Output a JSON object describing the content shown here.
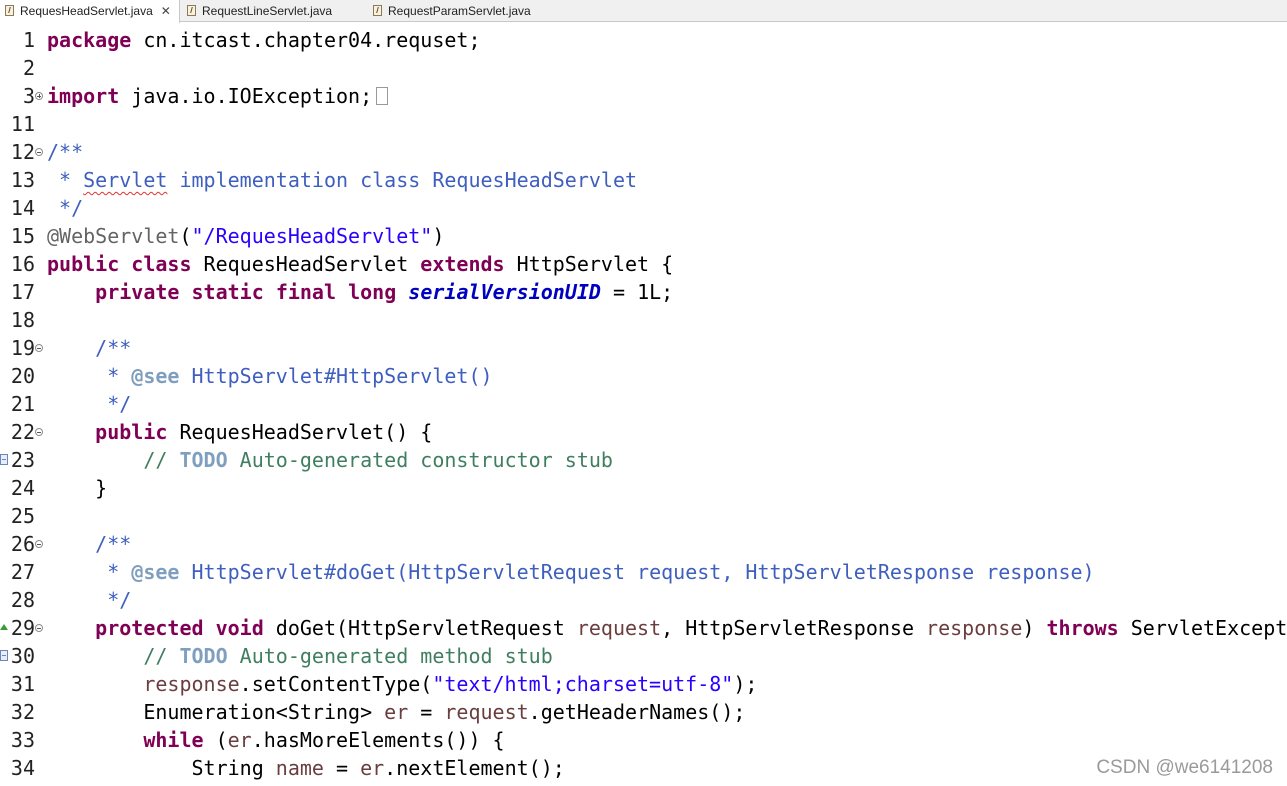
{
  "tabs": [
    {
      "label": "RequesHeadServlet.java",
      "active": true,
      "close": "✕"
    },
    {
      "label": "RequestLineServlet.java",
      "active": false
    },
    {
      "label": "RequestParamServlet.java",
      "active": false
    }
  ],
  "colors": {
    "keyword": "#7f0055",
    "comment": "#3f7f5f",
    "javadoc": "#3f5fbf",
    "string": "#2a00ff",
    "field": "#0000c0",
    "variable": "#6a3e3e"
  },
  "watermark": "CSDN @we6141208",
  "lines": [
    {
      "n": "1",
      "t": [
        [
          "kw",
          "package"
        ],
        [
          "p",
          " cn.itcast.chapter04.requset;"
        ]
      ]
    },
    {
      "n": "2",
      "t": []
    },
    {
      "n": "3",
      "fold": "plus",
      "collapsed": true,
      "t": [
        [
          "kw",
          "import"
        ],
        [
          "p",
          " java.io.IOException;"
        ]
      ]
    },
    {
      "n": "11",
      "t": []
    },
    {
      "n": "12",
      "fold": "minus",
      "t": [
        [
          "jd",
          "/**"
        ]
      ]
    },
    {
      "n": "13",
      "t": [
        [
          "jd",
          " * "
        ],
        [
          "jdsq",
          "Servlet"
        ],
        [
          "jd",
          " implementation class RequesHeadServlet"
        ]
      ]
    },
    {
      "n": "14",
      "t": [
        [
          "jd",
          " */"
        ]
      ]
    },
    {
      "n": "15",
      "t": [
        [
          "ann",
          "@WebServlet"
        ],
        [
          "p",
          "("
        ],
        [
          "str",
          "\"/RequesHeadServlet\""
        ],
        [
          "p",
          ")"
        ]
      ]
    },
    {
      "n": "16",
      "t": [
        [
          "kw",
          "public"
        ],
        [
          "p",
          " "
        ],
        [
          "kw",
          "class"
        ],
        [
          "p",
          " RequesHeadServlet "
        ],
        [
          "kw",
          "extends"
        ],
        [
          "p",
          " HttpServlet {"
        ]
      ]
    },
    {
      "n": "17",
      "t": [
        [
          "p",
          "    "
        ],
        [
          "kw",
          "private"
        ],
        [
          "p",
          " "
        ],
        [
          "kw",
          "static"
        ],
        [
          "p",
          " "
        ],
        [
          "kw",
          "final"
        ],
        [
          "p",
          " "
        ],
        [
          "kw",
          "long"
        ],
        [
          "p",
          " "
        ],
        [
          "fld",
          "serialVersionUID"
        ],
        [
          "p",
          " = 1L;"
        ]
      ]
    },
    {
      "n": "18",
      "t": []
    },
    {
      "n": "19",
      "fold": "minus",
      "t": [
        [
          "p",
          "    "
        ],
        [
          "jd",
          "/**"
        ]
      ]
    },
    {
      "n": "20",
      "t": [
        [
          "p",
          "    "
        ],
        [
          "jd",
          " * "
        ],
        [
          "tag",
          "@see"
        ],
        [
          "jd",
          " HttpServlet#HttpServlet()"
        ]
      ]
    },
    {
      "n": "21",
      "t": [
        [
          "p",
          "    "
        ],
        [
          "jd",
          " */"
        ]
      ]
    },
    {
      "n": "22",
      "fold": "minus",
      "t": [
        [
          "p",
          "    "
        ],
        [
          "kw",
          "public"
        ],
        [
          "p",
          " RequesHeadServlet() {"
        ]
      ]
    },
    {
      "n": "23",
      "marker": true,
      "t": [
        [
          "p",
          "        "
        ],
        [
          "cm",
          "// "
        ],
        [
          "todo",
          "TODO"
        ],
        [
          "cm",
          " Auto-generated constructor stub"
        ]
      ]
    },
    {
      "n": "24",
      "t": [
        [
          "p",
          "    }"
        ]
      ]
    },
    {
      "n": "25",
      "t": []
    },
    {
      "n": "26",
      "fold": "minus",
      "t": [
        [
          "p",
          "    "
        ],
        [
          "jd",
          "/**"
        ]
      ]
    },
    {
      "n": "27",
      "t": [
        [
          "p",
          "    "
        ],
        [
          "jd",
          " * "
        ],
        [
          "tag",
          "@see"
        ],
        [
          "jd",
          " HttpServlet#doGet(HttpServletRequest request, HttpServletResponse response)"
        ]
      ]
    },
    {
      "n": "28",
      "t": [
        [
          "p",
          "    "
        ],
        [
          "jd",
          " */"
        ]
      ]
    },
    {
      "n": "29",
      "fold": "minus",
      "arrow": true,
      "t": [
        [
          "p",
          "    "
        ],
        [
          "kw",
          "protected"
        ],
        [
          "p",
          " "
        ],
        [
          "kw",
          "void"
        ],
        [
          "p",
          " doGet(HttpServletRequest "
        ],
        [
          "var",
          "request"
        ],
        [
          "p",
          ", HttpServletResponse "
        ],
        [
          "var",
          "response"
        ],
        [
          "p",
          ") "
        ],
        [
          "kw",
          "throws"
        ],
        [
          "p",
          " ServletException, IOException {"
        ]
      ]
    },
    {
      "n": "30",
      "marker": true,
      "t": [
        [
          "p",
          "        "
        ],
        [
          "cm",
          "// "
        ],
        [
          "todo",
          "TODO"
        ],
        [
          "cm",
          " Auto-generated method stub"
        ]
      ]
    },
    {
      "n": "31",
      "t": [
        [
          "p",
          "        "
        ],
        [
          "var",
          "response"
        ],
        [
          "p",
          ".setContentType("
        ],
        [
          "str",
          "\"text/html;charset=utf-8\""
        ],
        [
          "p",
          ");"
        ]
      ]
    },
    {
      "n": "32",
      "t": [
        [
          "p",
          "        Enumeration<String> "
        ],
        [
          "var",
          "er"
        ],
        [
          "p",
          " = "
        ],
        [
          "var",
          "request"
        ],
        [
          "p",
          ".getHeaderNames();"
        ]
      ]
    },
    {
      "n": "33",
      "t": [
        [
          "p",
          "        "
        ],
        [
          "kw",
          "while"
        ],
        [
          "p",
          " ("
        ],
        [
          "var",
          "er"
        ],
        [
          "p",
          ".hasMoreElements()) {"
        ]
      ]
    },
    {
      "n": "34",
      "t": [
        [
          "p",
          "            String "
        ],
        [
          "var",
          "name"
        ],
        [
          "p",
          " = "
        ],
        [
          "var",
          "er"
        ],
        [
          "p",
          ".nextElement();"
        ]
      ]
    }
  ]
}
